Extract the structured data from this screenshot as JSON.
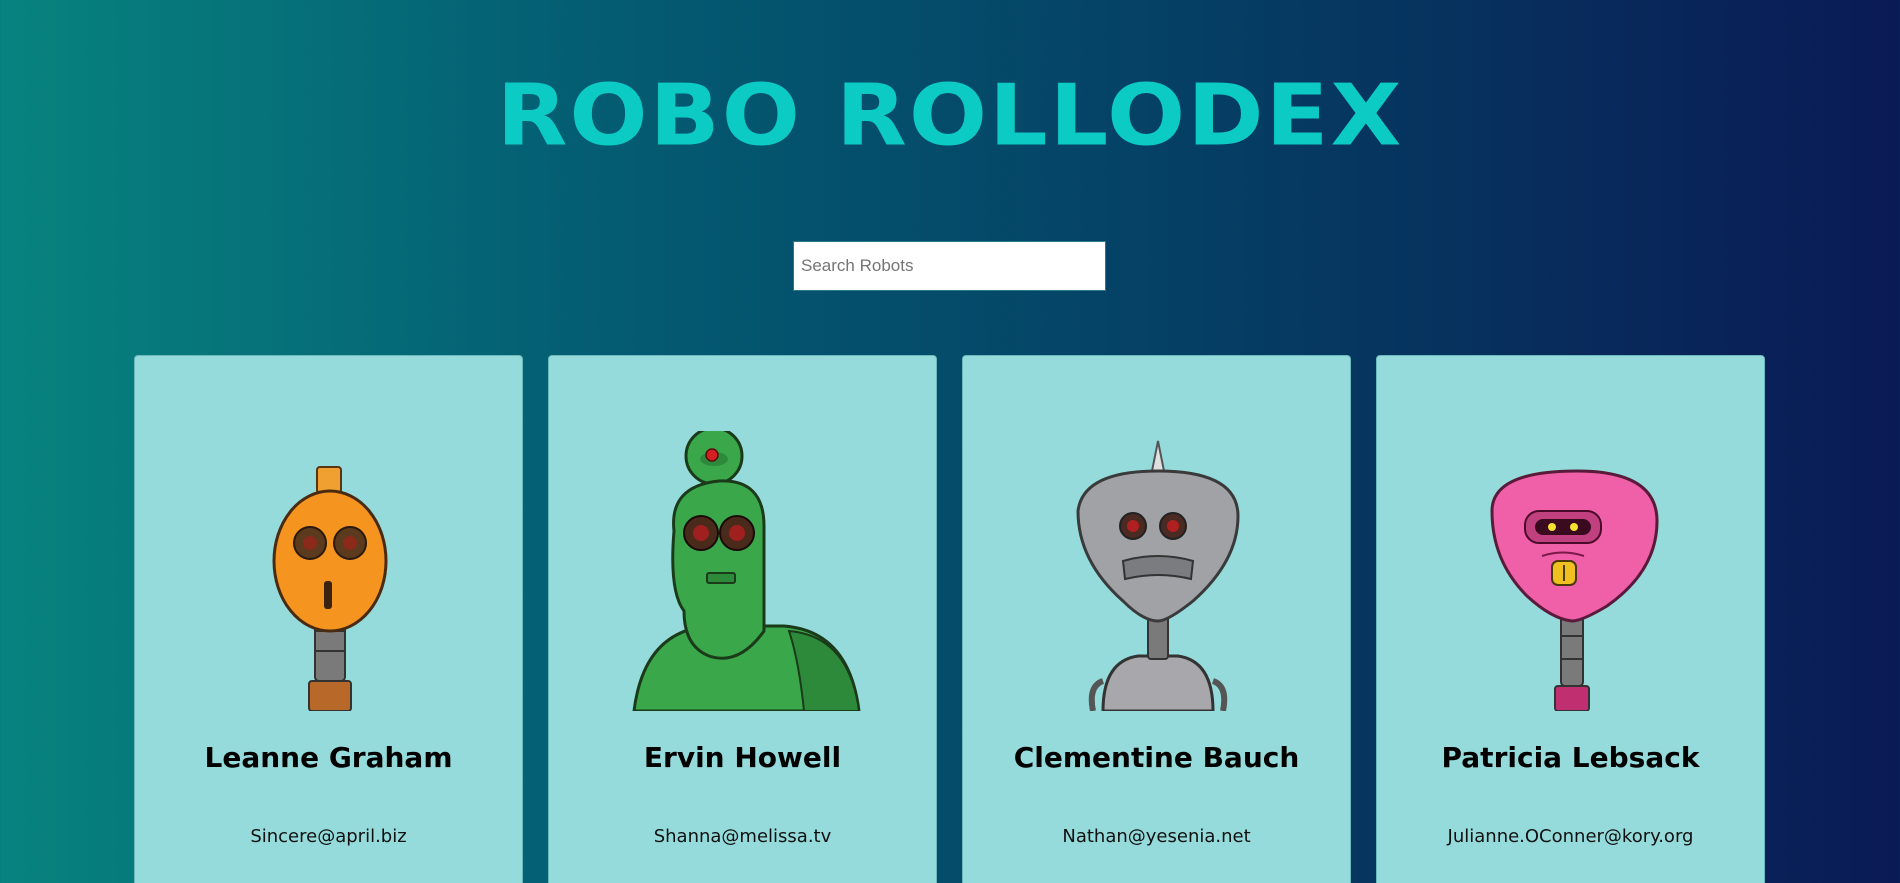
{
  "header": {
    "title": "ROBO ROLLODEX"
  },
  "search": {
    "placeholder": "Search Robots",
    "value": ""
  },
  "robots": [
    {
      "name": "Leanne Graham",
      "email": "Sincere@april.biz",
      "avatar": "orange-robot-avatar"
    },
    {
      "name": "Ervin Howell",
      "email": "Shanna@melissa.tv",
      "avatar": "green-robot-avatar"
    },
    {
      "name": "Clementine Bauch",
      "email": "Nathan@yesenia.net",
      "avatar": "gray-robot-avatar"
    },
    {
      "name": "Patricia Lebsack",
      "email": "Julianne.OConner@kory.org",
      "avatar": "pink-robot-avatar"
    }
  ],
  "colors": {
    "title": "#0ccac4",
    "card": "#95dbdb",
    "gradient_start": "#07837f",
    "gradient_end": "#0a1a55"
  }
}
